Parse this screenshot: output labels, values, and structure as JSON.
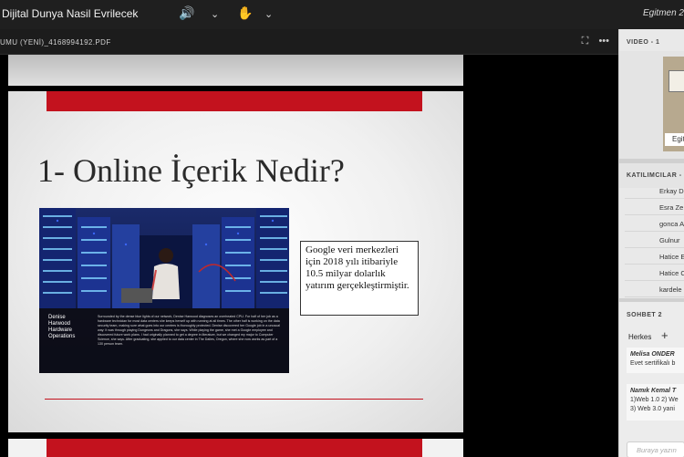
{
  "topbar": {
    "title": "Dijital Dunya Nasil Evrilecek",
    "audio_icon": "speaker-icon",
    "hand_icon": "raise-hand-icon",
    "right_text": "Egitmen 2"
  },
  "document": {
    "filename": "UMU (YENİ)_4168994192.PDF",
    "current_slide": {
      "heading": "1- Online İçerik Nedir?",
      "photo_caption_name": "Denise\nHarwood\nHardware\nOperations",
      "photo_caption_text": "Surrounded by the dense blue lights of our network, Denise Harwood diagnoses an overheated CPU. For half of her job as a hardware technician for most data centers she keeps herself up with running at all times. The other half is working on the data security team, making sure what goes into our centers is thoroughly protected. Denise discovered her Google job in a unusual way: It was through playing Dungeons and Dragons, she says. While playing the game, she met a Google employee and discovered future work plans. I had originally planned to get a degree in literature, but we changed my major to Computer Science, she says. After graduating, she applied to our data center in The Dalles, Oregon, where she now works as part of a 130 person team.",
      "text_box": "Google veri merkezleri için 2018 yılı itibariyle 10.5 milyar dolarlık yatırım gerçekleştirmiştir."
    }
  },
  "side_panel": {
    "video_header": "VIDEO - 1",
    "video_tag": "Egit",
    "participants_header": "KATILIMCILAR -",
    "participants": [
      "Erkay D",
      "Esra Ze",
      "gonca A",
      "Gulnur",
      "Hatice E",
      "Hatice C",
      "kardele"
    ],
    "chat_header": "SOHBET 2",
    "chat_to": "Herkes",
    "messages": [
      {
        "author": "Melisa ONDER",
        "lines": [
          "Evet sertifikalı b"
        ]
      },
      {
        "author": "Namık Kemal T",
        "lines": [
          "1)Web 1.0  2) We",
          "3) Web 3.0 yani"
        ]
      }
    ],
    "chat_placeholder": "Buraya yazın"
  },
  "colors": {
    "accent_red": "#c3121e",
    "topbar_bg": "#1f1f1f",
    "audio_green": "#35c46a"
  }
}
